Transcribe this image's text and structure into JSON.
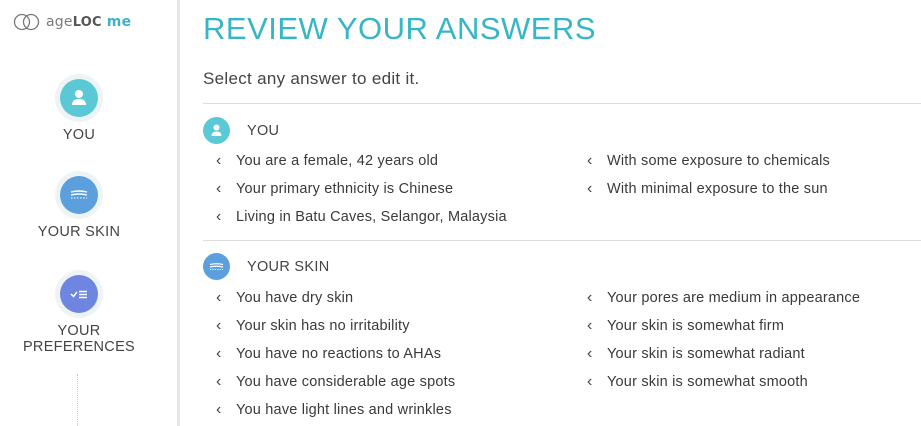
{
  "logo": {
    "prefix": "age",
    "mid": "LOC",
    "suffix": " me"
  },
  "sidebar": {
    "items": [
      {
        "label": "YOU",
        "icon": "person-icon"
      },
      {
        "label": "YOUR SKIN",
        "icon": "skin-layers-icon"
      },
      {
        "label_line1": "YOUR",
        "label_line2": "PREFERENCES",
        "icon": "checklist-icon"
      }
    ]
  },
  "main": {
    "title": "REVIEW YOUR ANSWERS",
    "subtitle": "Select any answer to edit it.",
    "sections": [
      {
        "label": "YOU",
        "icon": "person-icon",
        "col1": [
          "You are a female, 42 years old",
          "Your primary ethnicity is Chinese",
          "Living in Batu Caves, Selangor, Malaysia"
        ],
        "col2": [
          "With some exposure to chemicals",
          "With minimal exposure to the sun"
        ]
      },
      {
        "label": "YOUR SKIN",
        "icon": "skin-layers-icon",
        "col1": [
          "You have dry skin",
          "Your skin has no irritability",
          "You have no reactions to AHAs",
          "You have considerable age spots",
          "You have light lines and wrinkles"
        ],
        "col2": [
          "Your pores are medium in appearance",
          "Your skin is somewhat firm",
          "Your skin is somewhat radiant",
          "Your skin is somewhat smooth"
        ]
      }
    ]
  },
  "colors": {
    "teal": "#36b6c6",
    "you": "#5bc8d6",
    "skin": "#5b9fdc",
    "preferences": "#6f86e0"
  },
  "chevron": "‹"
}
